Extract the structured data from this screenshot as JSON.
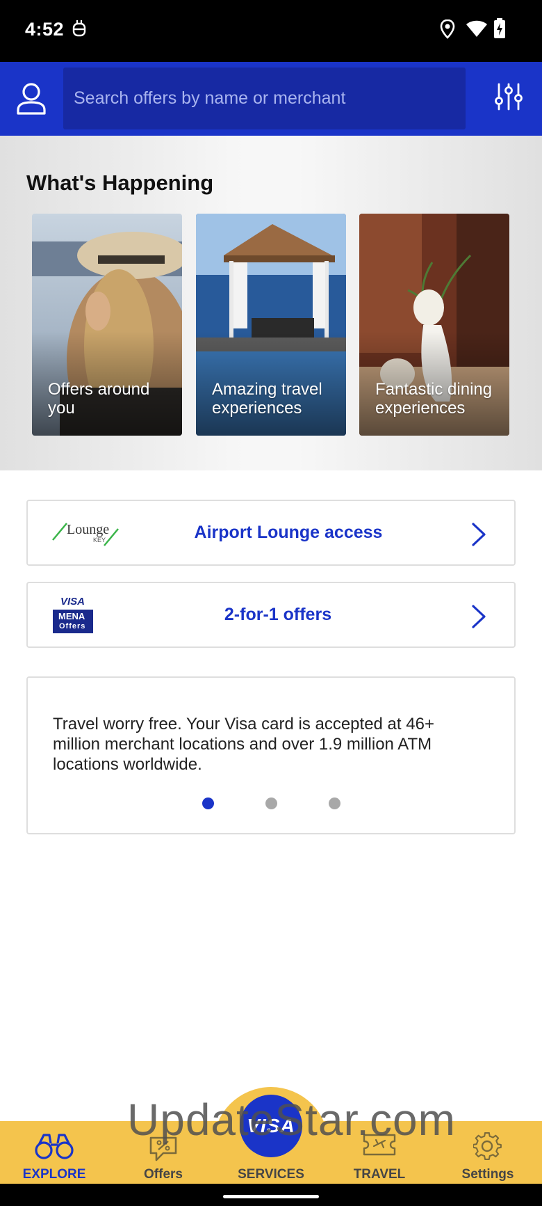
{
  "status_bar": {
    "time": "4:52",
    "icons": [
      "robot-icon",
      "location-icon",
      "wifi-icon",
      "battery-charging-icon"
    ]
  },
  "header": {
    "search_placeholder": "Search offers by name or merchant",
    "icons": [
      "profile-icon",
      "filter-sliders-icon"
    ]
  },
  "happening": {
    "title": "What's Happening",
    "cards": [
      {
        "label": "Offers around you"
      },
      {
        "label": "Amazing travel experiences"
      },
      {
        "label": "Fantastic dining experiences"
      }
    ]
  },
  "links": [
    {
      "label": "Airport Lounge access",
      "logo_text": "Lounge",
      "logo_sub": "KEY"
    },
    {
      "label": "2-for-1 offers",
      "logo_text": "VISA",
      "logo_sub1": "MENA",
      "logo_sub2": "Offers"
    }
  ],
  "info_card": {
    "text": "Travel worry free. Your Visa card is accepted at 46+ million merchant locations and over 1.9 million ATM locations worldwide.",
    "carousel_active_page": 1,
    "carousel_total_pages": 3
  },
  "bottom_nav": {
    "items": [
      {
        "label": "EXPLORE",
        "icon": "binoculars-icon",
        "active": true
      },
      {
        "label": "Offers",
        "icon": "percent-tag-icon",
        "active": false
      },
      {
        "label": "SERVICES",
        "icon": "visa-logo",
        "active": false
      },
      {
        "label": "TRAVEL",
        "icon": "plane-ticket-icon",
        "active": false
      },
      {
        "label": "Settings",
        "icon": "gear-icon",
        "active": false
      }
    ],
    "center_logo": "VISA"
  },
  "watermark": "UpdateStar.com",
  "colors": {
    "primary": "#1a34c8",
    "search_bg": "#1729a3",
    "nav_bg": "#f4c44d",
    "inactive_dot": "#a8a8a8"
  }
}
